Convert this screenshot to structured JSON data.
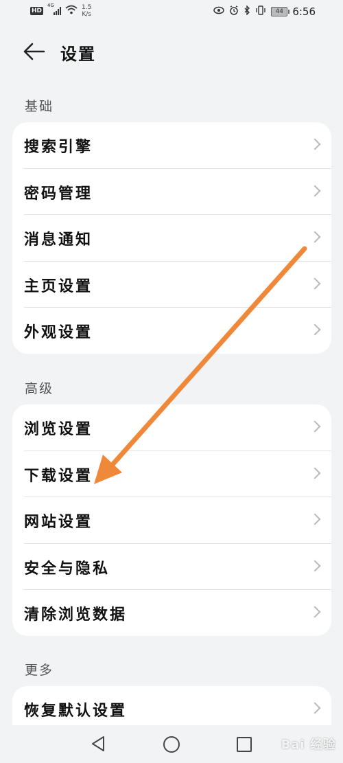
{
  "status_bar": {
    "hd_label": "HD",
    "signal_label": "4G",
    "net_speed_value": "1.5",
    "net_speed_unit": "K/s",
    "battery_level": "44",
    "time": "6:56"
  },
  "header": {
    "title": "设置"
  },
  "sections": {
    "basic": {
      "title": "基础",
      "items": [
        {
          "label": "搜索引擎"
        },
        {
          "label": "密码管理"
        },
        {
          "label": "消息通知"
        },
        {
          "label": "主页设置"
        },
        {
          "label": "外观设置"
        }
      ]
    },
    "advanced": {
      "title": "高级",
      "items": [
        {
          "label": "浏览设置"
        },
        {
          "label": "下载设置"
        },
        {
          "label": "网站设置"
        },
        {
          "label": "安全与隐私"
        },
        {
          "label": "清除浏览数据"
        }
      ]
    },
    "more": {
      "title": "更多",
      "items": [
        {
          "label": "恢复默认设置"
        }
      ]
    }
  },
  "watermark": {
    "text": "Bai 经验"
  },
  "colors": {
    "annotation_arrow": "#f0883a",
    "background": "#f1f3f5",
    "card": "#ffffff"
  }
}
